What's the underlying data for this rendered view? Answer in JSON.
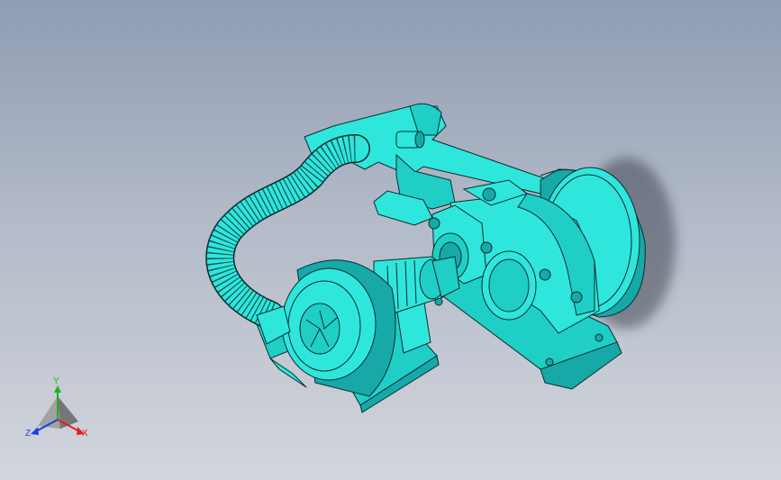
{
  "viewport": {
    "background_top": "#8f9cb2",
    "background_bottom": "#d2d5dc"
  },
  "model": {
    "color": "#2fe6dc",
    "edge_color": "#0a2c2c",
    "shade_color": "#16a9a8",
    "components": [
      "rocker-arm-icon",
      "flywheel-icon",
      "gearbox-icon",
      "motor-icon",
      "blower-fan-icon",
      "flexible-hose-icon"
    ]
  },
  "triad": {
    "x_label": "X",
    "y_label": "Y",
    "z_label": "Z",
    "x_color": "#e02020",
    "y_color": "#20b020",
    "z_color": "#2040e0"
  }
}
